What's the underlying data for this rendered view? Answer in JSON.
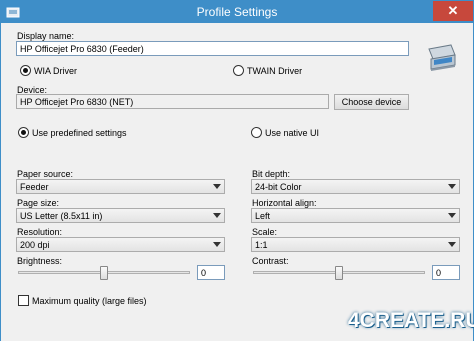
{
  "window": {
    "title": "Profile Settings",
    "close_glyph": "✕",
    "app_icon": "app-icon"
  },
  "display_name": {
    "label": "Display name:",
    "value": "HP Officejet Pro 6830 (Feeder)"
  },
  "driver": {
    "wia_label": "WIA Driver",
    "twain_label": "TWAIN Driver",
    "selected": "WIA Driver"
  },
  "device": {
    "label": "Device:",
    "value": "HP Officejet Pro 6830 (NET)",
    "choose_button": "Choose device"
  },
  "settings_mode": {
    "predefined_label": "Use predefined settings",
    "native_label": "Use native UI",
    "selected": "Use predefined settings"
  },
  "left_fields": {
    "paper_source": {
      "label": "Paper source:",
      "value": "Feeder"
    },
    "page_size": {
      "label": "Page size:",
      "value": "US Letter (8.5x11 in)"
    },
    "resolution": {
      "label": "Resolution:",
      "value": "200 dpi"
    },
    "brightness": {
      "label": "Brightness:",
      "value": "0",
      "level": 0.5
    }
  },
  "right_fields": {
    "bit_depth": {
      "label": "Bit depth:",
      "value": "24-bit Color"
    },
    "horizontal_align": {
      "label": "Horizontal align:",
      "value": "Left"
    },
    "scale": {
      "label": "Scale:",
      "value": "1:1"
    },
    "contrast": {
      "label": "Contrast:",
      "value": "0",
      "level": 0.5
    }
  },
  "max_quality": {
    "label": "Maximum quality (large files)",
    "checked": false
  },
  "watermark": {
    "text": "4CREATE.RU"
  },
  "colors": {
    "titlebar": "#3e8ec8",
    "close": "#c7483c",
    "background": "#f0f0f0"
  }
}
